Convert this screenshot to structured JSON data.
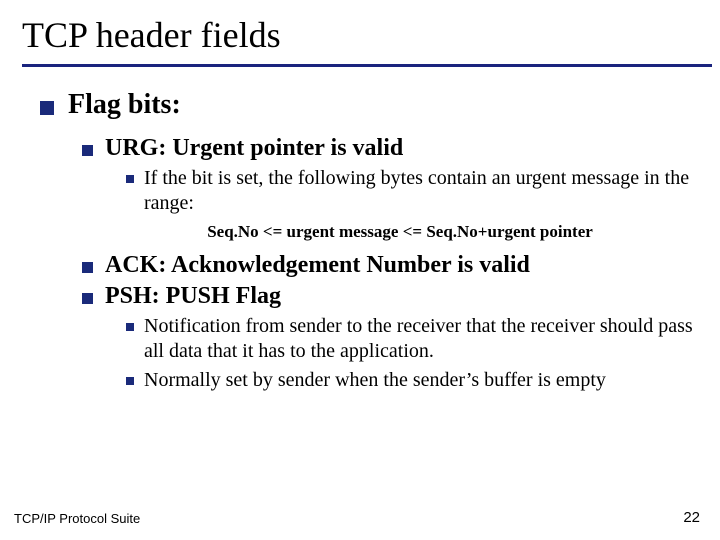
{
  "title": "TCP header fields",
  "lvl1": {
    "label": "Flag bits:"
  },
  "urg": {
    "label": "URG:   Urgent pointer is valid",
    "sub1": "If the bit is set, the following bytes contain an urgent message in the range:",
    "range": "Seq.No <= urgent message <= Seq.No+urgent pointer"
  },
  "ack": {
    "label": "ACK: Acknowledgement Number is valid"
  },
  "psh": {
    "label": "PSH:  PUSH Flag",
    "sub1": "Notification from sender to the receiver that the receiver should pass all data that it has to the application.",
    "sub2": "Normally set by sender when the sender’s buffer is empty"
  },
  "footer": {
    "left": "TCP/IP Protocol Suite",
    "right": "22"
  }
}
